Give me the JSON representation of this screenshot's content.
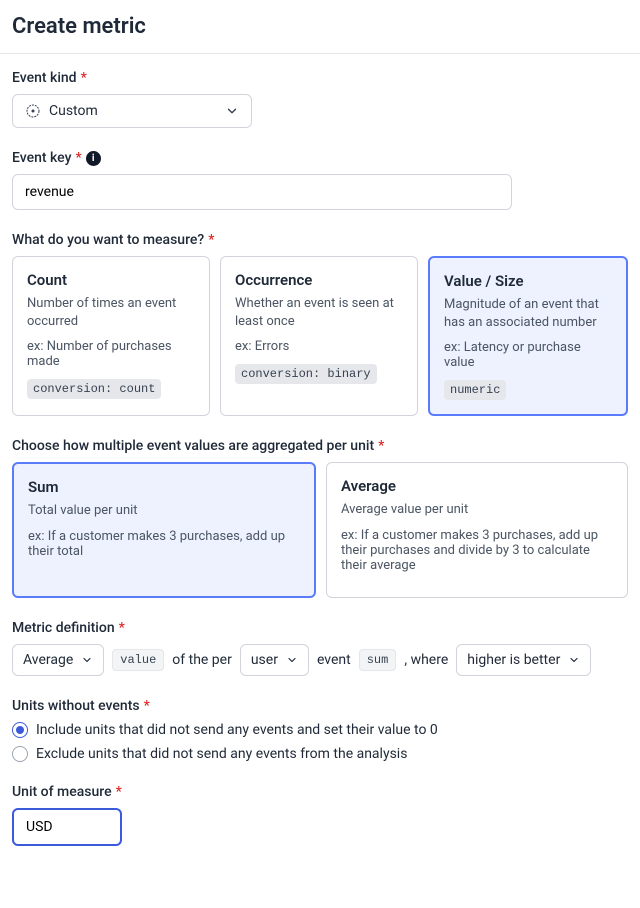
{
  "title": "Create metric",
  "event_kind": {
    "label": "Event kind",
    "value": "Custom"
  },
  "event_key": {
    "label": "Event key",
    "value": "revenue"
  },
  "measure": {
    "label": "What do you want to measure?",
    "options": [
      {
        "title": "Count",
        "desc": "Number of times an event occurred",
        "ex": "ex: Number of purchases made",
        "tag": "conversion: count",
        "selected": false
      },
      {
        "title": "Occurrence",
        "desc": "Whether an event is seen at least once",
        "ex": "ex: Errors",
        "tag": "conversion: binary",
        "selected": false
      },
      {
        "title": "Value / Size",
        "desc": "Magnitude of an event that has an associated number",
        "ex": "ex: Latency or purchase value",
        "tag": "numeric",
        "selected": true
      }
    ]
  },
  "aggregate": {
    "label": "Choose how multiple event values are aggregated per unit",
    "options": [
      {
        "title": "Sum",
        "desc": "Total value per unit",
        "ex": "ex: If a customer makes 3 purchases, add up their total",
        "selected": true
      },
      {
        "title": "Average",
        "desc": "Average value per unit",
        "ex": "ex: If a customer makes 3 purchases, add up their purchases and divide by 3 to calculate their average",
        "selected": false
      }
    ]
  },
  "definition": {
    "label": "Metric definition",
    "outer": "Average",
    "value_chip": "value",
    "text1": "of the per",
    "unit": "user",
    "text2": "event",
    "inner_chip": "sum",
    "text3": ", where",
    "direction": "higher is better"
  },
  "units_without": {
    "label": "Units without events",
    "options": [
      {
        "text": "Include units that did not send any events and set their value to 0",
        "checked": true
      },
      {
        "text": "Exclude units that did not send any events from the analysis",
        "checked": false
      }
    ]
  },
  "unit_of_measure": {
    "label": "Unit of measure",
    "value": "USD"
  }
}
